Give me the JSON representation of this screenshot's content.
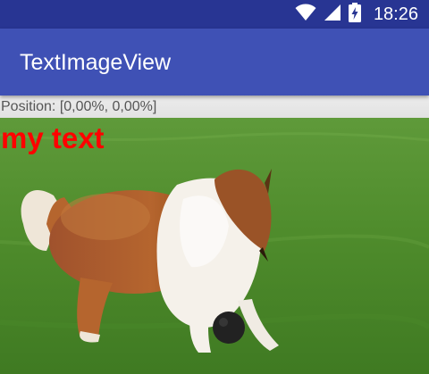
{
  "status_bar": {
    "time": "18:26",
    "background_color": "#283593",
    "icons": [
      "wifi-icon",
      "cell-signal-icon",
      "battery-charging-icon"
    ]
  },
  "app_bar": {
    "title": "TextImageView",
    "background_color": "#3f51b5"
  },
  "image_view": {
    "position_label": "Position: [0,00%, 0,00%]",
    "overlay_text": "my text",
    "overlay_text_color": "#ff0000",
    "image_subject": "collie-dog-on-grass"
  }
}
